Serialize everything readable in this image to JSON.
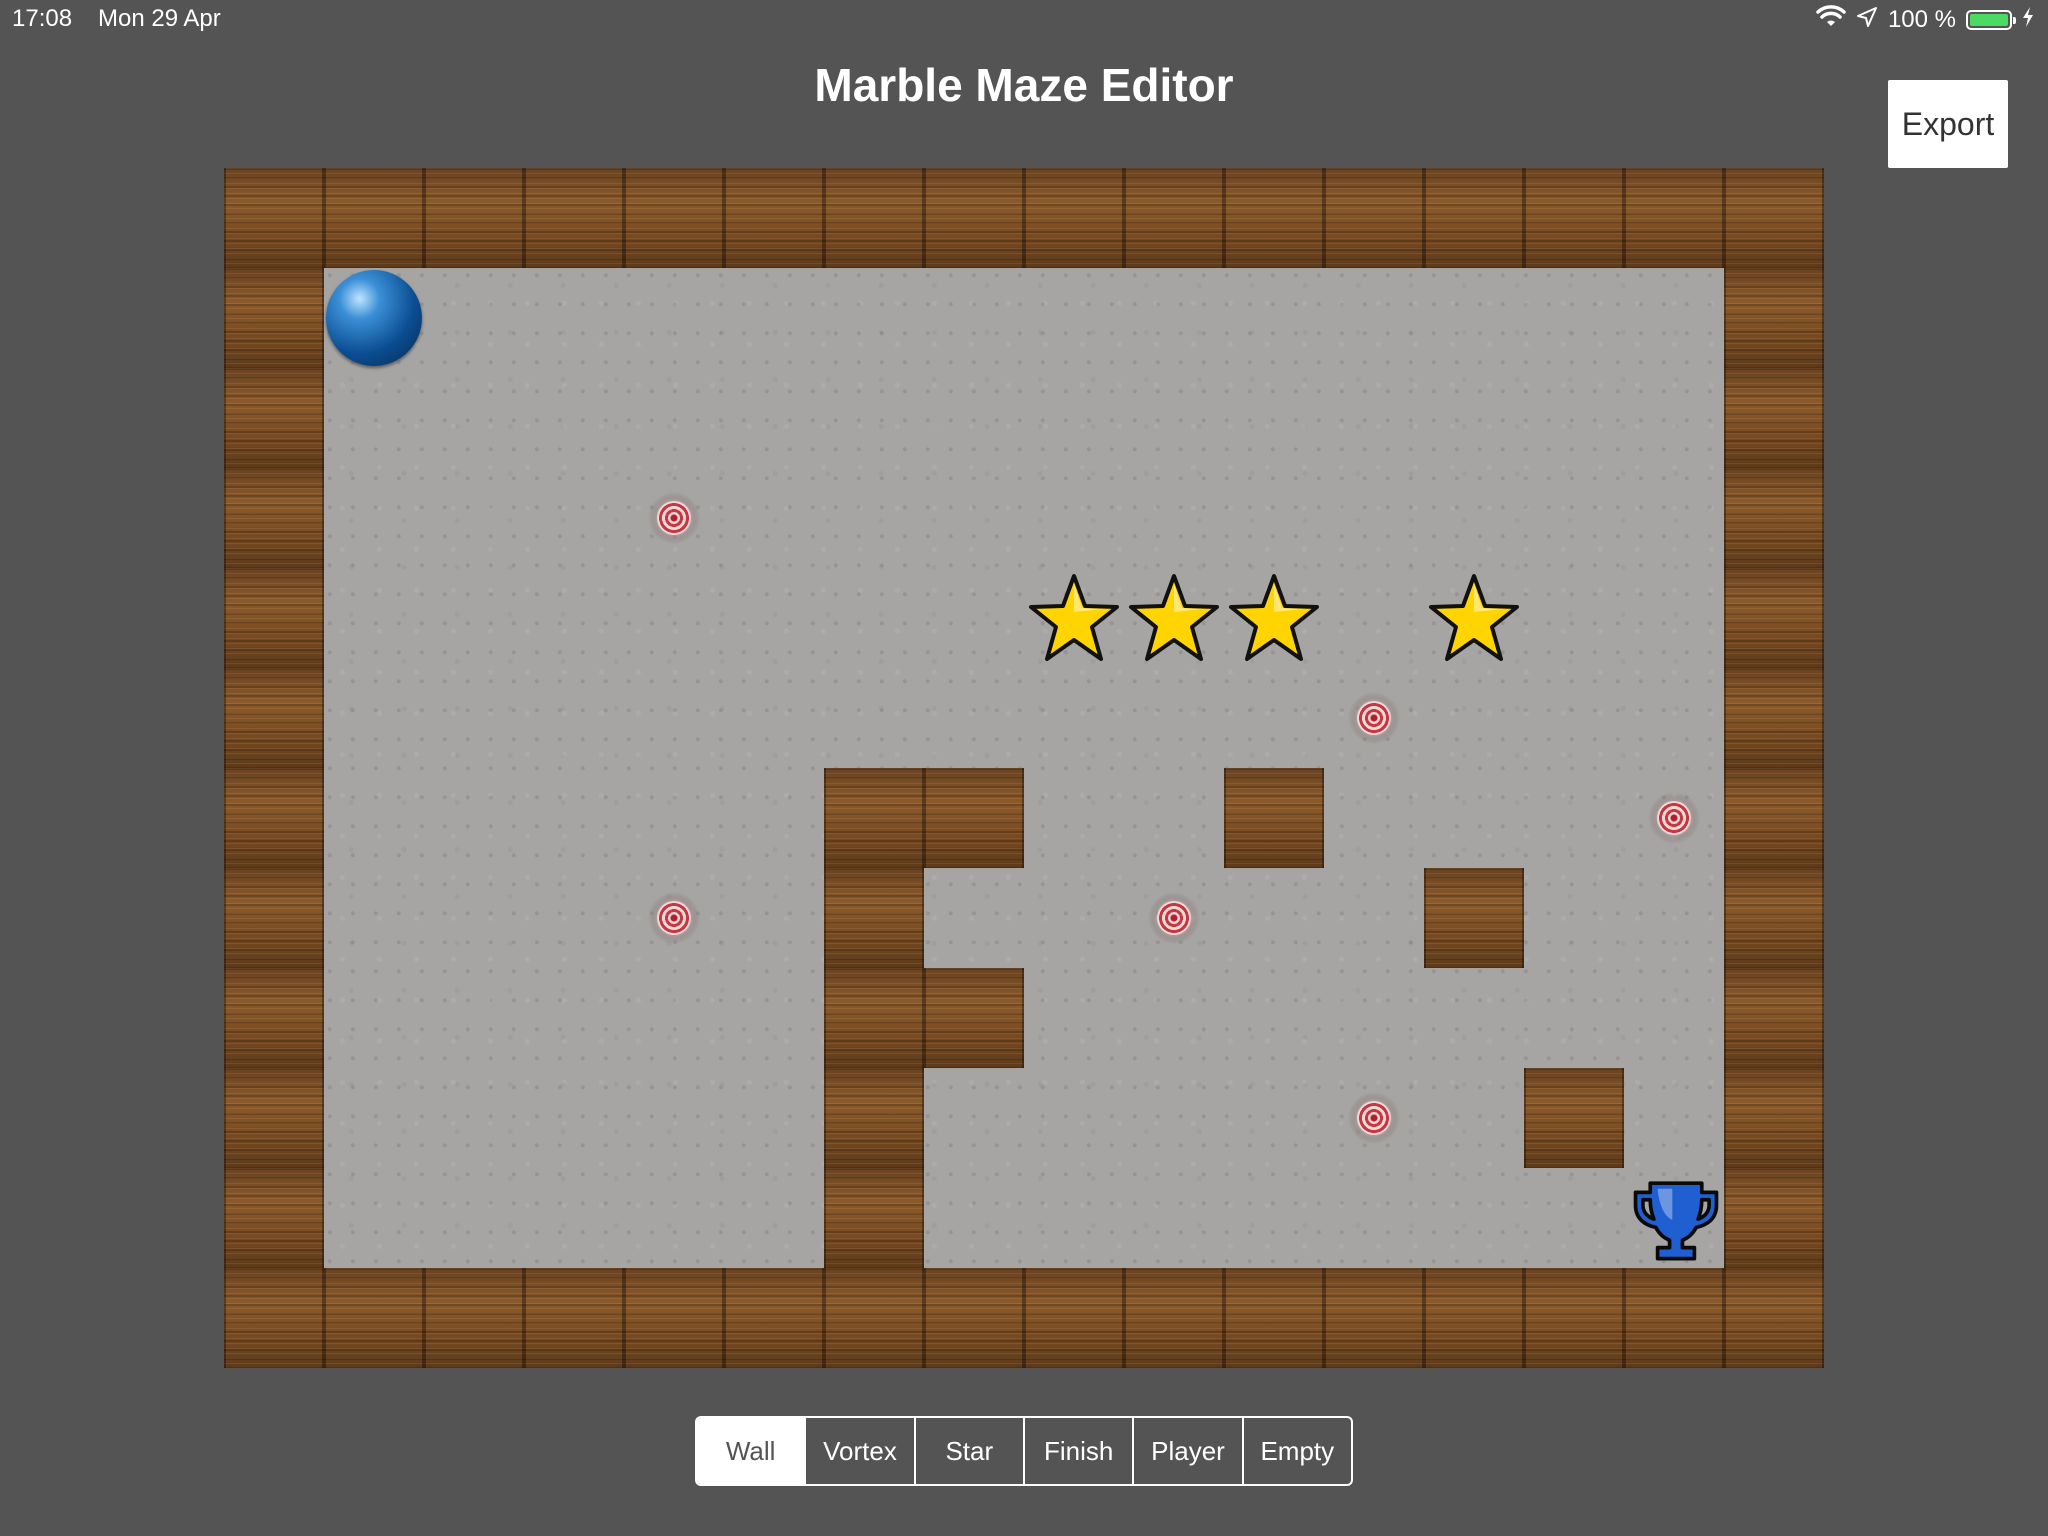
{
  "status_bar": {
    "time": "17:08",
    "date": "Mon 29 Apr",
    "battery_percent": "100 %",
    "battery_level": 1.0,
    "icons": [
      "wifi-icon",
      "location-arrow-icon",
      "battery-icon",
      "charging-bolt-icon"
    ]
  },
  "title": "Marble Maze Editor",
  "export_label": "Export",
  "maze": {
    "columns": 16,
    "rows": 12,
    "legend": {
      "W": "wall",
      "V": "vortex",
      "S": "star",
      "F": "finish",
      "P": "player",
      ".": "empty"
    },
    "grid": [
      "WWWWWWWWWWWWWWWW",
      "WP.............W",
      "W...............W",
      "W...V..........W",
      "W.......SSS.S..W",
      "W..........V...W",
      "W.....WW..W...VW",
      "W...V.W..V..W..W",
      "W.....WW.......W",
      "W.....W....V.W.W",
      "W.....W.......FW",
      "WWWWWWWWWWWWWWWW"
    ]
  },
  "tools": {
    "selected": "Wall",
    "items": [
      "Wall",
      "Vortex",
      "Star",
      "Finish",
      "Player",
      "Empty"
    ]
  },
  "colors": {
    "background": "#545454",
    "star_fill": "#ffd400",
    "trophy_fill": "#1f5fd1",
    "marble": "#0b4d92",
    "battery_fill": "#4cd964"
  }
}
